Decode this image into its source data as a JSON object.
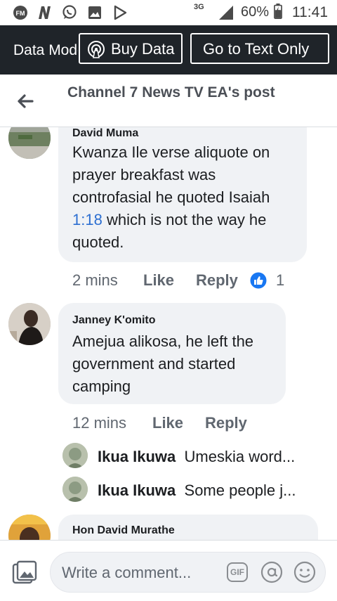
{
  "status_bar": {
    "network": "3G",
    "battery": "60%",
    "time": "11:41"
  },
  "data_banner": {
    "mode_text": "Data Mode",
    "buy_label": "Buy Data",
    "text_only_label": "Go to Text Only"
  },
  "header": {
    "title": "Channel 7 News TV EA's post"
  },
  "comments": [
    {
      "author": "David Muma",
      "text_before_link": "Kwanza Ile verse aliquote on prayer breakfast was controfasial he quoted Isaiah ",
      "link": "1:18",
      "text_after_link": " which is not the way he quoted.",
      "time": "2 mins",
      "like_label": "Like",
      "reply_label": "Reply",
      "reaction_count": "1"
    },
    {
      "author": "Janney K'omito",
      "text": "Amejua alikosa, he left the government and started camping",
      "time": "12 mins",
      "like_label": "Like",
      "reply_label": "Reply",
      "replies": [
        {
          "author": "Ikua Ikuwa",
          "preview": "Umeskia word..."
        },
        {
          "author": "Ikua Ikuwa",
          "preview": "Some people j..."
        }
      ]
    },
    {
      "author": "Hon David Murathe"
    }
  ],
  "composer": {
    "placeholder": "Write a comment...",
    "gif_label": "GIF"
  },
  "colors": {
    "banner_bg": "#1f2429",
    "bubble_bg": "#f0f2f5",
    "link": "#2d6fd1",
    "like_reaction": "#1877f2"
  }
}
